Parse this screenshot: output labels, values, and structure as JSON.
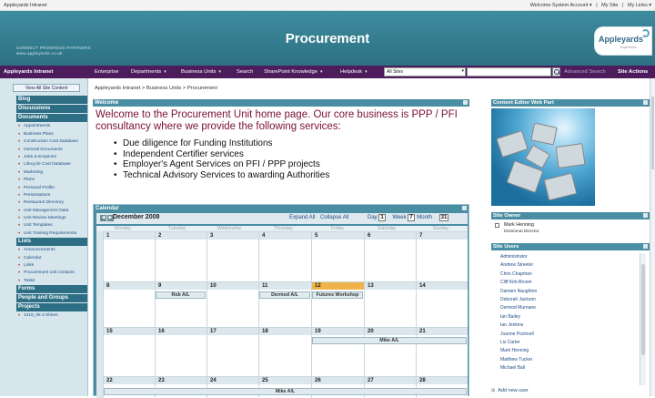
{
  "topbar": {
    "site_name": "Appleyards Intranet",
    "account": "Welcome System Account ▾",
    "my_site": "My Site",
    "my_links": "My Links ▾"
  },
  "banner": {
    "tagline_line1": "CONNECT PROGRESS PARTNERS",
    "tagline_line2": "www.appleyards.co.uk",
    "title": "Procurement",
    "logo_text": "Appleyards",
    "logo_sub": "Experience"
  },
  "nav": {
    "items": [
      {
        "label": "Appleyards Intranet",
        "chevron": false
      },
      {
        "label": "Enterprise",
        "chevron": false
      },
      {
        "label": "Departments",
        "chevron": true
      },
      {
        "label": "Business Units",
        "chevron": true
      },
      {
        "label": "Search",
        "chevron": false
      },
      {
        "label": "SharePoint Knowledge",
        "chevron": true
      },
      {
        "label": "Helpdesk",
        "chevron": true
      }
    ],
    "scope": "All Sites",
    "advanced_search": "Advanced Search",
    "site_actions": "Site Actions"
  },
  "leftnav": {
    "view_all": "View All Site Content",
    "groups": [
      {
        "label": "Blog",
        "items": []
      },
      {
        "label": "Discussions",
        "items": []
      },
      {
        "label": "Documents",
        "items": [
          "Appointments",
          "Business Plans",
          "Construction Cost Database",
          "General Documents",
          "Jobs & Enquiries",
          "Lifecycle Cost Database",
          "Marketing",
          "Plans",
          "Personal Profile",
          "Presentations",
          "Restaurant Directory",
          "Unit Management Data",
          "Unit Review Meetings",
          "Unit Templates",
          "Unit Training Requirements"
        ]
      },
      {
        "label": "Lists",
        "items": [
          "Announcements",
          "Calendar",
          "Links",
          "Procurement unit contacts",
          "Tasks"
        ]
      },
      {
        "label": "Forms",
        "items": []
      },
      {
        "label": "People and Groups",
        "items": []
      },
      {
        "label": "Projects",
        "items": [
          "1318_06 3 Shires"
        ]
      }
    ]
  },
  "breadcrumb": "Appleyards Intranet > Business Units > Procurement",
  "welcome": {
    "header": "Welcome",
    "text": "Welcome to the Procurement Unit home page. Our core business is PPP / PFI consultancy where we provide the following services:",
    "services": [
      "Due diligence for Funding Institutions",
      "Independent Certifier services",
      "Employer's Agent Services on PFI / PPP projects",
      "Technical Advisory Services to awarding Authorities"
    ]
  },
  "calendar": {
    "header": "Calendar",
    "month": "December 2008",
    "expand_all": "Expand All",
    "collapse_all": "Collapse All",
    "day_label": "Day",
    "day_icon": "1",
    "week_label": "Week",
    "week_icon": "7",
    "month_label": "Month",
    "month_icon": "31",
    "dow": [
      "Monday",
      "Tuesday",
      "Wednesday",
      "Thursday",
      "Friday",
      "Saturday",
      "Sunday"
    ],
    "weeks": [
      [
        "1",
        "2",
        "3",
        "4",
        "5",
        "6",
        "7"
      ],
      [
        "8",
        "9",
        "10",
        "11",
        "12",
        "13",
        "14"
      ],
      [
        "15",
        "16",
        "17",
        "18",
        "19",
        "20",
        "21"
      ],
      [
        "22",
        "23",
        "24",
        "25",
        "26",
        "27",
        "28"
      ]
    ],
    "events": [
      "Rob A/L",
      "Dermod A/L",
      "Futures Workshop",
      "Mike A/L",
      "Mike A/L"
    ]
  },
  "right": {
    "cewp_header": "Content Editor Web Part",
    "owner_header": "Site Owner",
    "owner_name": "Mark Henning",
    "owner_role": "Divisional Director",
    "users_header": "Site Users",
    "users": [
      "Administrator",
      "Andrew Streeter",
      "Chris Chapman",
      "Cliff Kirk-Brown",
      "Damien Naughton",
      "Deborah Jackson",
      "Dermod Murnane",
      "Ian Bailey",
      "Ian Jenkins",
      "Joanne Pocknell",
      "Liz Carter",
      "Mark Henning",
      "Matthew Tucker",
      "Michael Ball"
    ],
    "add_user": "Add new user"
  }
}
